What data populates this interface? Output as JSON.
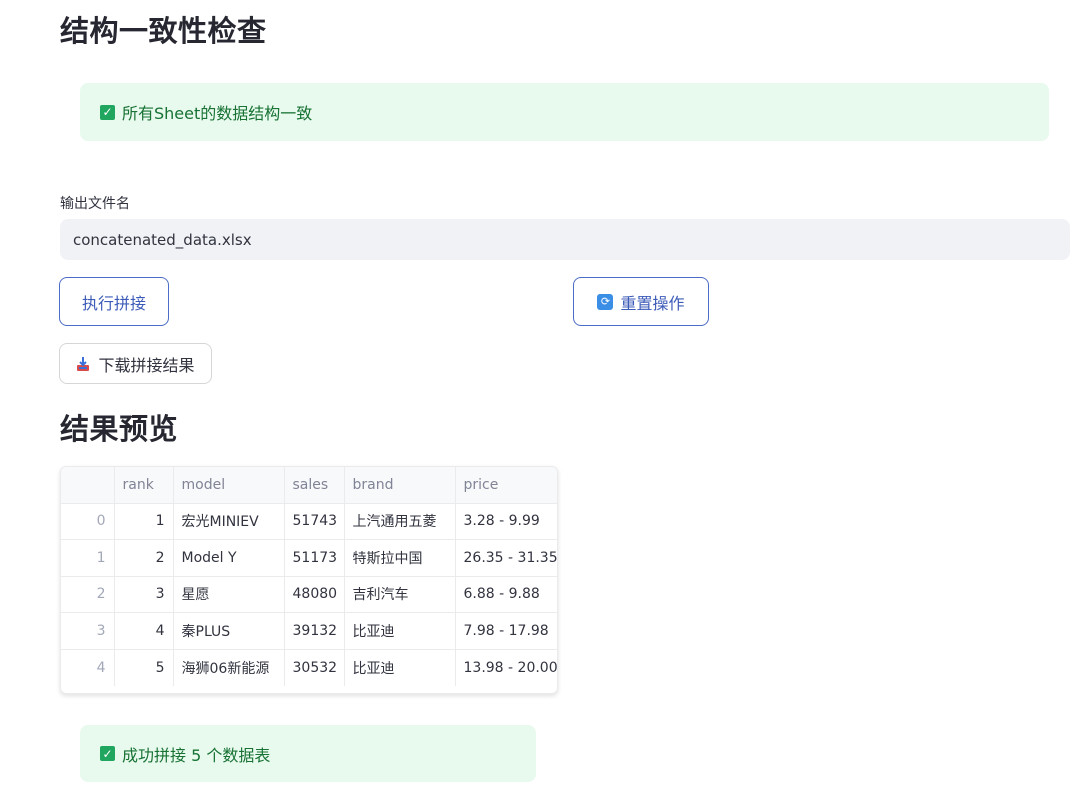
{
  "check_section": {
    "title": "结构一致性检查",
    "alert_text": "所有Sheet的数据结构一致"
  },
  "output": {
    "label": "输出文件名",
    "value": "concatenated_data.xlsx"
  },
  "buttons": {
    "execute_label": "执行拼接",
    "reset_label": "重置操作",
    "download_label": "下载拼接结果"
  },
  "icons": {
    "check": "check-box-icon",
    "reset": "refresh-icon",
    "download": "inbox-tray-icon"
  },
  "colors": {
    "success_bg": "#e8f9ee",
    "success_text": "#177233",
    "primary_border": "#4b6cc7"
  },
  "preview": {
    "title": "结果预览",
    "columns": [
      "",
      "rank",
      "model",
      "sales",
      "brand",
      "price"
    ],
    "rows": [
      {
        "index": "0",
        "rank": "1",
        "model": "宏光MINIEV",
        "sales": "51743",
        "brand": "上汽通用五菱",
        "price": "3.28 - 9.99"
      },
      {
        "index": "1",
        "rank": "2",
        "model": "Model Y",
        "sales": "51173",
        "brand": "特斯拉中国",
        "price": "26.35 - 31.35"
      },
      {
        "index": "2",
        "rank": "3",
        "model": "星愿",
        "sales": "48080",
        "brand": "吉利汽车",
        "price": "6.88 - 9.88"
      },
      {
        "index": "3",
        "rank": "4",
        "model": "秦PLUS",
        "sales": "39132",
        "brand": "比亚迪",
        "price": "7.98 - 17.98"
      },
      {
        "index": "4",
        "rank": "5",
        "model": "海狮06新能源",
        "sales": "30532",
        "brand": "比亚迪",
        "price": "13.98 - 20.00"
      }
    ]
  },
  "result": {
    "alert_text": "成功拼接 5 个数据表"
  }
}
